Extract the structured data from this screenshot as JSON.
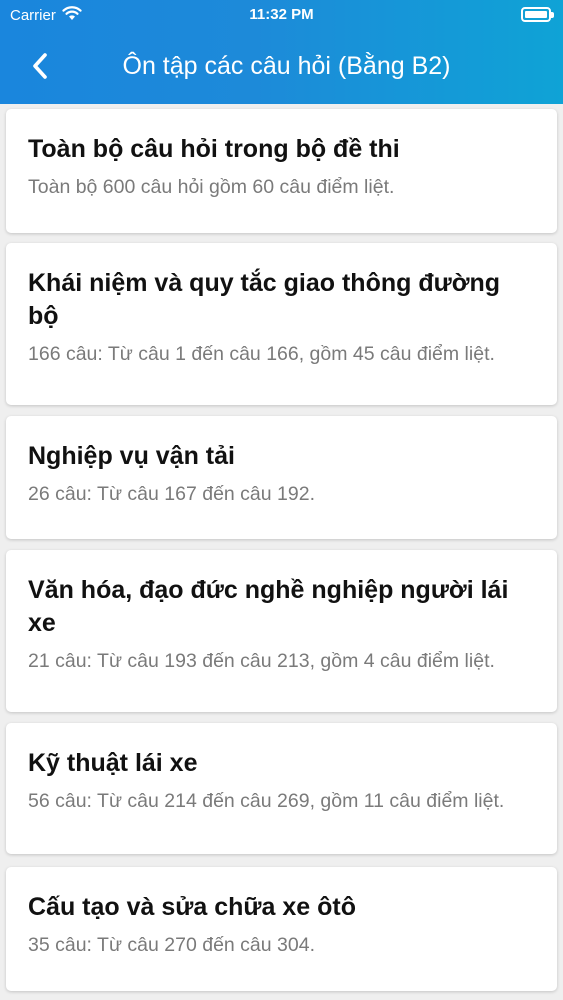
{
  "status_bar": {
    "carrier": "Carrier",
    "time": "11:32 PM",
    "wifi_icon": "wifi-icon",
    "battery_icon": "battery-icon"
  },
  "nav": {
    "title": "Ôn tập các câu hỏi (Bằng B2)",
    "back_icon": "chevron-left-icon"
  },
  "colors": {
    "header_start": "#1a86dd",
    "header_end": "#0fa3d6",
    "background": "#efefef",
    "card": "#ffffff",
    "subtitle": "#7a7a7a"
  },
  "items": [
    {
      "title": "Toàn bộ câu hỏi trong bộ đề thi",
      "subtitle": "Toàn bộ 600 câu hỏi gồm 60 câu điểm liệt."
    },
    {
      "title": "Khái niệm và quy tắc giao thông đường bộ",
      "subtitle": "166 câu: Từ câu 1 đến câu 166, gồm 45 câu điểm liệt."
    },
    {
      "title": "Nghiệp vụ vận tải",
      "subtitle": "26 câu: Từ câu 167 đến câu 192."
    },
    {
      "title": "Văn hóa, đạo đức nghề nghiệp người lái xe",
      "subtitle": "21 câu: Từ câu 193 đến câu 213, gồm 4 câu điểm liệt."
    },
    {
      "title": "Kỹ thuật lái xe",
      "subtitle": "56 câu: Từ câu 214 đến câu 269, gồm 11 câu điểm liệt."
    },
    {
      "title": "Cấu tạo và sửa chữa xe ôtô",
      "subtitle": "35 câu: Từ câu 270 đến câu 304."
    }
  ]
}
